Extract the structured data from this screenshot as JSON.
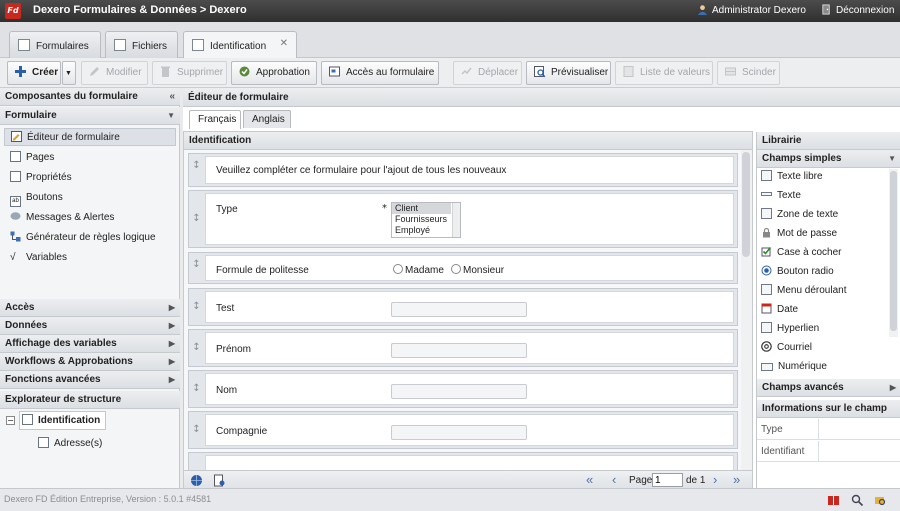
{
  "titlebar": {
    "logo": "Fd",
    "title": "Dexero Formulaires & Données > Dexero",
    "user": "Administrator Dexero",
    "logout": "Déconnexion"
  },
  "tabs": [
    {
      "label": "Formulaires"
    },
    {
      "label": "Fichiers"
    },
    {
      "label": "Identification",
      "close": "✕"
    }
  ],
  "toolbar": {
    "create": "Créer",
    "modify": "Modifier",
    "delete": "Supprimer",
    "approval": "Approbation",
    "form_access": "Accès au formulaire",
    "move": "Déplacer",
    "preview": "Prévisualiser",
    "value_list": "Liste de valeurs",
    "split": "Scinder"
  },
  "left": {
    "header": "Composantes du formulaire",
    "section": "Formulaire",
    "items": [
      {
        "label": "Éditeur de formulaire"
      },
      {
        "label": "Pages"
      },
      {
        "label": "Propriétés"
      },
      {
        "label": "Boutons"
      },
      {
        "label": "Messages & Alertes"
      },
      {
        "label": "Générateur de règles logique"
      },
      {
        "label": "Variables"
      }
    ],
    "groups": [
      {
        "label": "Accès"
      },
      {
        "label": "Données"
      },
      {
        "label": "Affichage des variables"
      },
      {
        "label": "Workflows & Approbations"
      },
      {
        "label": "Fonctions avancées"
      }
    ],
    "explorer": {
      "header": "Explorateur de structure",
      "root": "Identification",
      "child": "Adresse(s)",
      "collapse": "−"
    }
  },
  "editor": {
    "header": "Éditeur de formulaire",
    "lang_tabs": [
      {
        "label": "Français"
      },
      {
        "label": "Anglais"
      }
    ],
    "panel_title": "Identification",
    "rows": {
      "intro": "Veuillez compléter ce formulaire pour l'ajout de tous les nouveaux",
      "type_label": "Type",
      "required": "*",
      "type_options": [
        "Client",
        "Fournisseurs",
        "Employé"
      ],
      "politesse_label": "Formule de politesse",
      "radio_options": [
        "Madame",
        "Monsieur"
      ],
      "test_label": "Test",
      "prenom_label": "Prénom",
      "nom_label": "Nom",
      "compagnie_label": "Compagnie",
      "handle": "↕"
    },
    "pager": {
      "page_label": "Page",
      "page_value": "1",
      "of_label": "de 1",
      "first": "«",
      "prev": "‹",
      "next": "›",
      "last": "»"
    }
  },
  "library": {
    "header": "Librairie",
    "simple_header": "Champs simples",
    "items": [
      {
        "label": "Texte libre"
      },
      {
        "label": "Texte"
      },
      {
        "label": "Zone de texte"
      },
      {
        "label": "Mot de passe"
      },
      {
        "label": "Case à cocher"
      },
      {
        "label": "Bouton radio"
      },
      {
        "label": "Menu déroulant"
      },
      {
        "label": "Date"
      },
      {
        "label": "Hyperlien"
      },
      {
        "label": "Courriel"
      },
      {
        "label": "Numérique"
      }
    ],
    "advanced_header": "Champs avancés",
    "info_header": "Informations sur le champ",
    "info_rows": [
      {
        "label": "Type"
      },
      {
        "label": "Identifiant"
      }
    ]
  },
  "status": {
    "version": "Dexero FD Édition Entreprise, Version : 5.0.1 #4581"
  },
  "colors": {
    "titlebar": "#3a3a3a",
    "logo": "#c8281e",
    "link": "#4a74a8"
  }
}
